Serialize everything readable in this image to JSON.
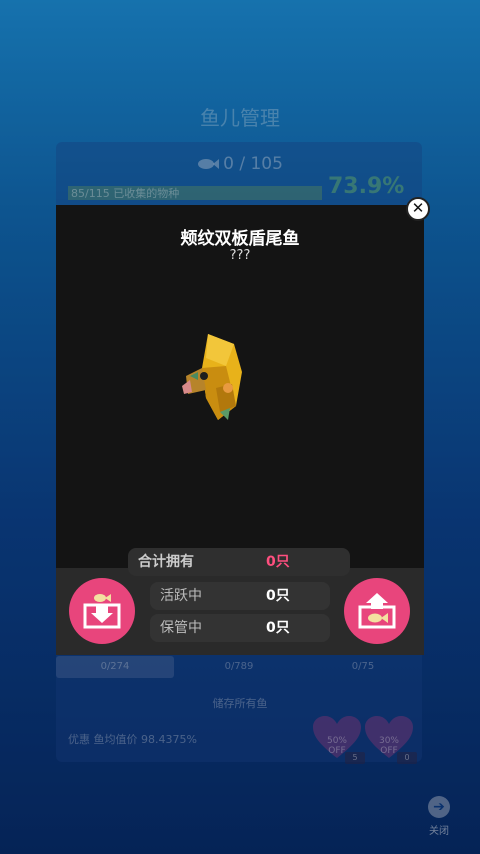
{
  "background": {
    "title": "鱼儿管理",
    "count": "0 / 105",
    "progress_label": "85/115 已收集的物种",
    "progress_fraction": 0.739,
    "percent": "73.9%",
    "tabs": [
      "0/274",
      "0/789",
      "0/75"
    ],
    "store_all": "储存所有鱼",
    "discount": "优惠 鱼均值价 98.4375%",
    "offers": [
      {
        "pct": "50%",
        "off": "OFF",
        "count": "5"
      },
      {
        "pct": "30%",
        "off": "OFF",
        "count": "0"
      }
    ],
    "close_label": "关闭",
    "close_icon": "arrow-right-icon"
  },
  "modal": {
    "fish_name": "颊纹双板盾尾鱼",
    "fish_sub": "???",
    "close_icon": "close-icon",
    "stats": {
      "total_label": "合计拥有",
      "total_value": "0只",
      "active_label": "活跃中",
      "active_value": "0只",
      "kept_label": "保管中",
      "kept_value": "0只"
    },
    "store_icon": "store-fish-icon",
    "release_icon": "release-fish-icon"
  },
  "colors": {
    "accent_pink": "#e8457c",
    "highlight_pink": "#ff4f7f",
    "fish_yellow": "#e8b21a"
  }
}
